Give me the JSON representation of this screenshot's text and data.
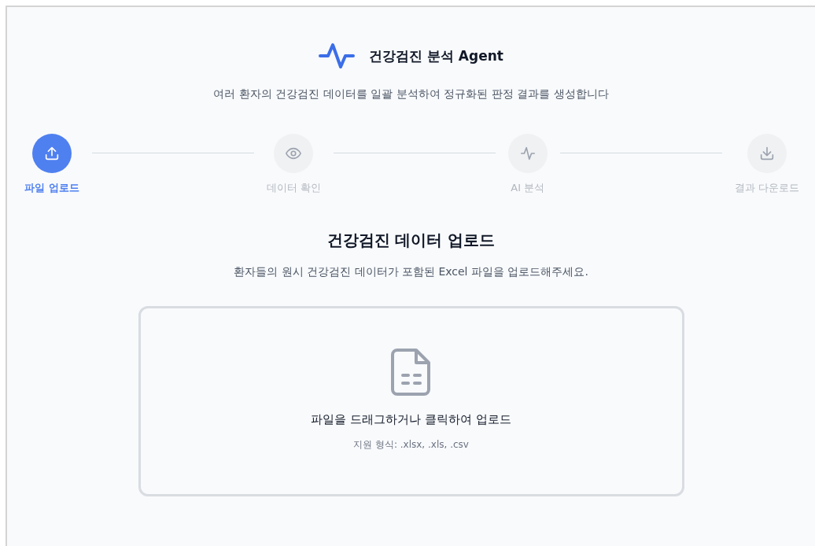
{
  "header": {
    "title": "건강검진 분석 Agent",
    "subtitle": "여러 환자의 건강검진 데이터를 일괄 분석하여 정규화된 판정 결과를 생성합니다"
  },
  "steps": [
    {
      "kind": "upload",
      "label": "파일 업로드",
      "selected": true
    },
    {
      "kind": "view",
      "label": "데이터 확인",
      "selected": false
    },
    {
      "kind": "analyze",
      "label": "AI 분석",
      "selected": false
    },
    {
      "kind": "download",
      "label": "결과 다운로드",
      "selected": false
    }
  ],
  "section": {
    "title": "건강검진 데이터 업로드",
    "description": "환자들의 원시 건강검진 데이터가 포함된 Excel 파일을 업로드해주세요."
  },
  "dropzone": {
    "prompt": "파일을 드래그하거나 클릭하여 업로드",
    "formats": "지원 형식: .xlsx, .xls, .csv"
  }
}
